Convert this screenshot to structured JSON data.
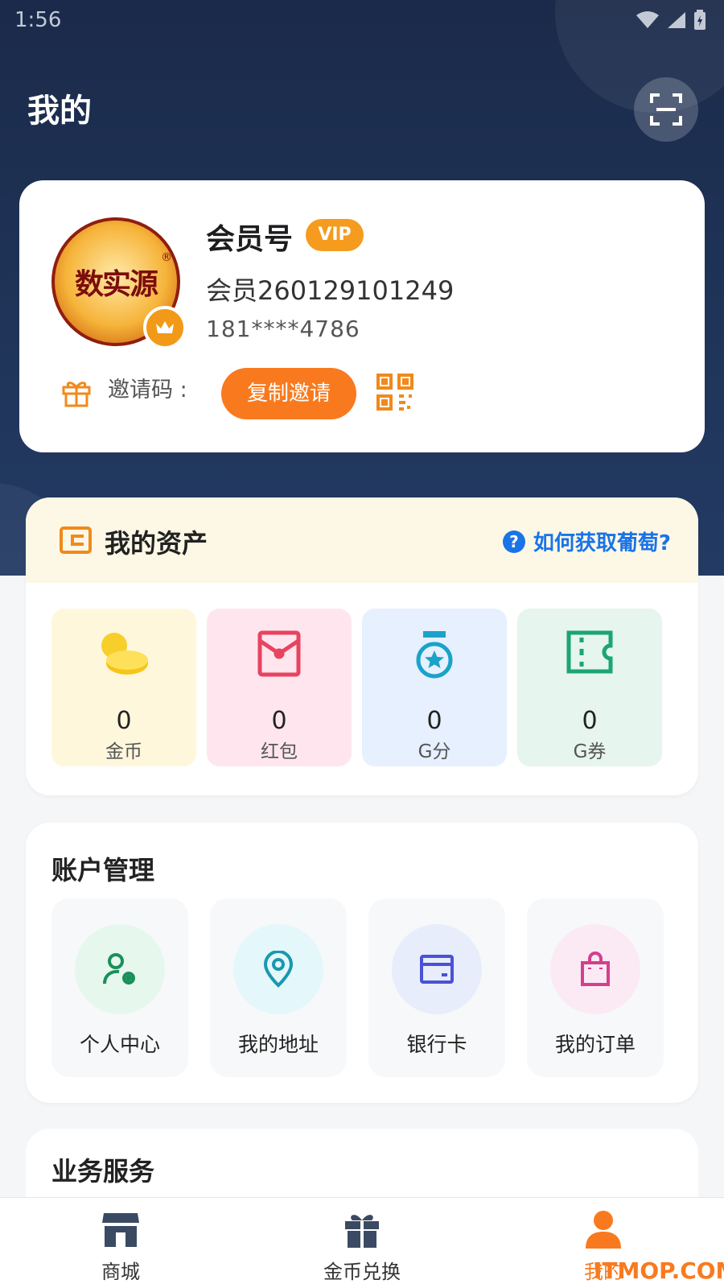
{
  "status_bar": {
    "time": "1:56"
  },
  "header": {
    "title": "我的"
  },
  "profile": {
    "avatar_logo_text": "数实源",
    "avatar_reg_mark": "®",
    "member_title": "会员号",
    "vip_badge": "VIP",
    "member_number": "会员260129101249",
    "phone": "181****4786",
    "invite_label": "邀请码 :",
    "copy_invite_label": "复制邀请"
  },
  "assets": {
    "title": "我的资产",
    "help_link": "如何获取葡萄?",
    "help_icon": "?",
    "items": [
      {
        "value": "0",
        "label": "金币",
        "icon": "coin-icon",
        "bg": "#fff7dc",
        "color": "#f5c518"
      },
      {
        "value": "0",
        "label": "红包",
        "icon": "red-envelope-icon",
        "bg": "#ffe6ee",
        "color": "#e8435f"
      },
      {
        "value": "0",
        "label": "G分",
        "icon": "medal-icon",
        "bg": "#e6f0ff",
        "color": "#1aa3c9"
      },
      {
        "value": "0",
        "label": "G券",
        "icon": "ticket-icon",
        "bg": "#e6f5ee",
        "color": "#1aa575"
      }
    ]
  },
  "account": {
    "title": "账户管理",
    "items": [
      {
        "label": "个人中心",
        "icon": "user-settings-icon",
        "circle": "#e6f7ee",
        "color": "#1a8f5a"
      },
      {
        "label": "我的地址",
        "icon": "location-icon",
        "circle": "#e4f7fa",
        "color": "#1a97b0"
      },
      {
        "label": "银行卡",
        "icon": "bank-card-icon",
        "circle": "#e8edfb",
        "color": "#4a52d6"
      },
      {
        "label": "我的订单",
        "icon": "shopping-bag-icon",
        "circle": "#fbeaf3",
        "color": "#d43f8d"
      }
    ]
  },
  "business": {
    "title": "业务服务"
  },
  "nav": {
    "items": [
      {
        "label": "商城",
        "icon": "store-icon"
      },
      {
        "label": "金币兑换",
        "icon": "gift-icon"
      },
      {
        "label": "我的",
        "icon": "person-icon",
        "active": true
      }
    ]
  },
  "watermark": "ITMOP.COM",
  "colors": {
    "accent": "#f97a1e",
    "link": "#1a73e8",
    "header_bg": "#1f3458"
  }
}
